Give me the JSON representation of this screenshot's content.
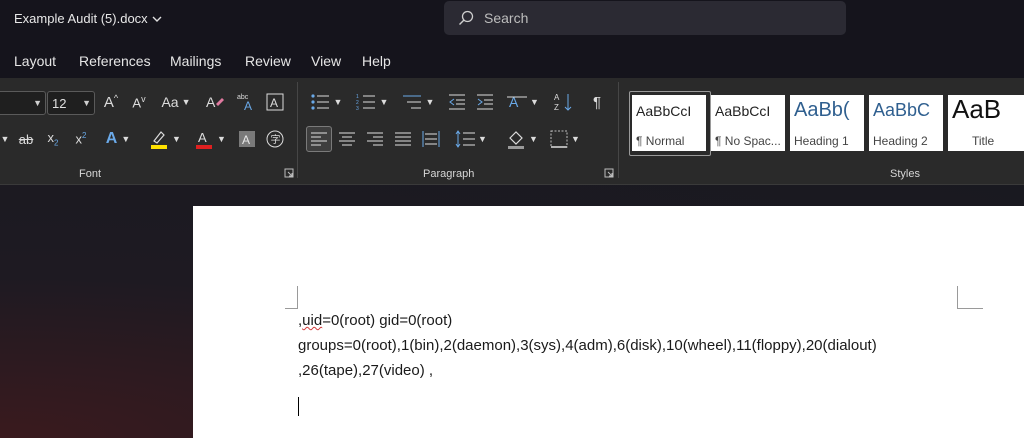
{
  "titlebar": {
    "doc_title": "Example Audit (5).docx",
    "search_placeholder": "Search"
  },
  "menu": [
    "Layout",
    "References",
    "Mailings",
    "Review",
    "View",
    "Help"
  ],
  "font": {
    "size": "12",
    "case_label": "Aa",
    "group_label": "Font"
  },
  "paragraph": {
    "group_label": "Paragraph"
  },
  "styles": {
    "group_label": "Styles",
    "items": [
      {
        "preview": "AaBbCcI",
        "label": "¶ Normal"
      },
      {
        "preview": "AaBbCcI",
        "label": "¶ No Spac..."
      },
      {
        "preview": "AaBb(",
        "label": "Heading 1"
      },
      {
        "preview": "AaBbC",
        "label": "Heading 2"
      },
      {
        "preview": "AaB",
        "label": "Title"
      }
    ]
  },
  "document": {
    "line1_prefix": ",",
    "line1_word": "uid",
    "line1_rest": "=0(root) gid=0(root)",
    "line2": "groups=0(root),1(bin),2(daemon),3(sys),4(adm),6(disk),10(wheel),11(floppy),20(dialout)",
    "line3": ",26(tape),27(video) ,"
  },
  "colors": {
    "highlight": "#ffe100",
    "font_color": "#e02020",
    "accent": "#4a90d9"
  }
}
